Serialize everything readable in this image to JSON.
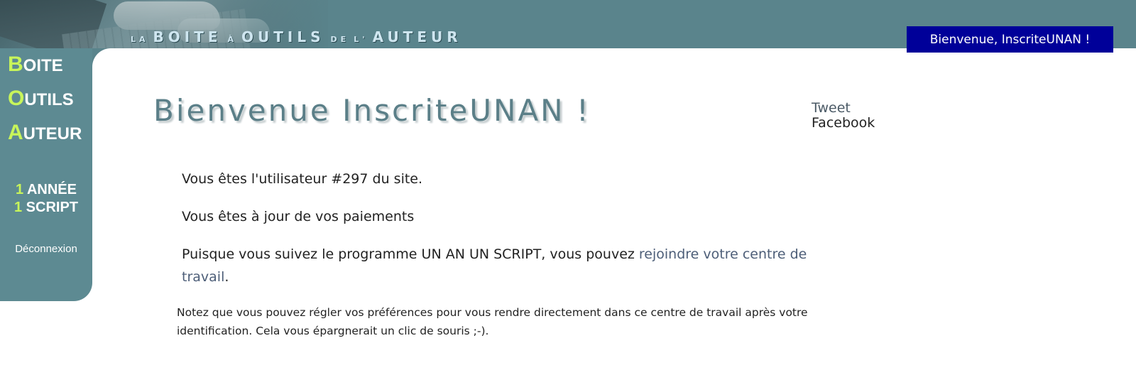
{
  "header": {
    "title_parts": [
      {
        "text": "LA",
        "size": "sm"
      },
      {
        "text": "BOITE",
        "size": "lg"
      },
      {
        "text": "À",
        "size": "sm"
      },
      {
        "text": "OUTILS",
        "size": "lg"
      },
      {
        "text": "DE",
        "size": "sm"
      },
      {
        "text": "L'",
        "size": "sm"
      },
      {
        "text": "AUTEUR",
        "size": "lg"
      }
    ],
    "welcome_badge": "Bienvenue, InscriteUNAN !"
  },
  "sidebar": {
    "brand": [
      {
        "cap": "B",
        "rest": "OITE"
      },
      {
        "cap": "O",
        "rest": "UTILS"
      },
      {
        "cap": "A",
        "rest": "UTEUR"
      }
    ],
    "program": [
      {
        "num": "1",
        "word": "ANNÉE"
      },
      {
        "num": "1",
        "word": "SCRIPT"
      }
    ],
    "logout_label": "Déconnexion"
  },
  "main": {
    "title": "Bienvenue InscriteUNAN !",
    "social": {
      "tweet_label": "Tweet",
      "facebook_label": "Facebook"
    },
    "user_number_text": "Vous êtes l'utilisateur #297 du site.",
    "payment_text": "Vous êtes à jour de vos paiements",
    "program_text_before": "Puisque vous suivez le programme UN AN UN SCRIPT, vous pouvez ",
    "program_link": "rejoindre votre centre de travail",
    "program_text_after": ".",
    "note": "Notez que vous pouvez régler vos préférences pour vous rendre directement dans ce centre de travail après votre identification. Cela vous épargnerait un clic de souris ;-)."
  },
  "colors": {
    "header_bg": "#5a848c",
    "sidebar_bg": "#5d8a92",
    "accent_green": "#c8f55a",
    "badge_bg": "#000099",
    "title_color": "#5b7f88",
    "link_color": "#4d5e78"
  }
}
